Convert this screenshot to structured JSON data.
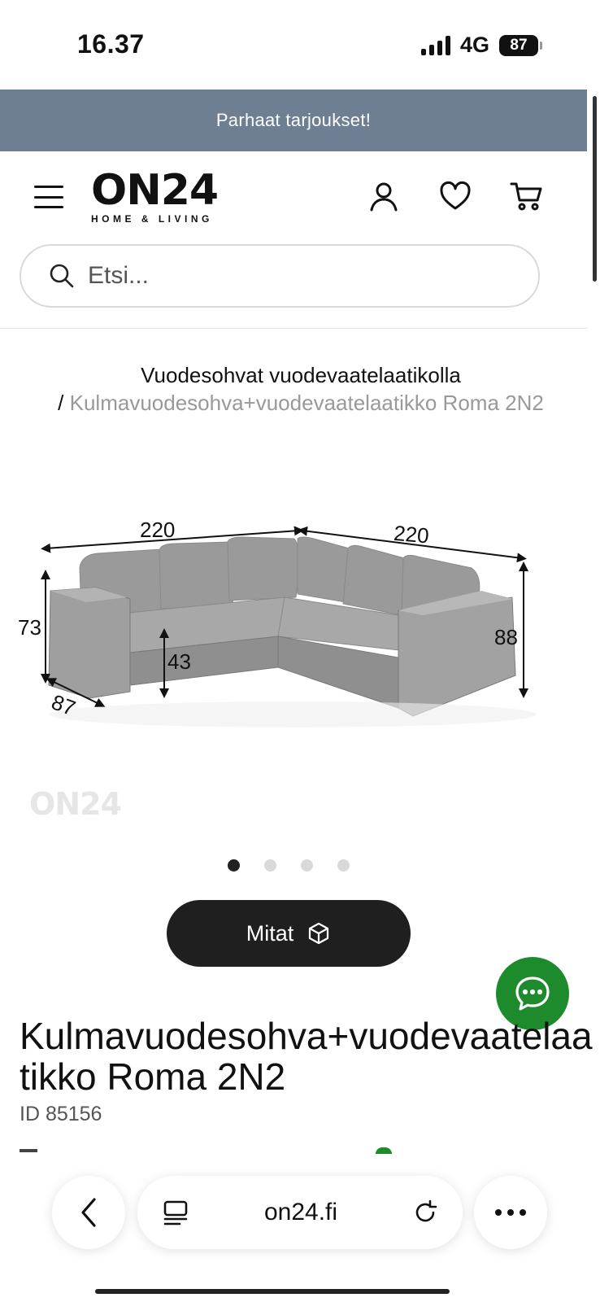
{
  "status_bar": {
    "time": "16.37",
    "network": "4G",
    "battery": "87"
  },
  "promo": {
    "text": "Parhaat tarjoukset!"
  },
  "header": {
    "logo_main": "ON24",
    "logo_sub": "HOME & LIVING",
    "icons": [
      "menu-icon",
      "user-icon",
      "heart-icon",
      "cart-icon"
    ]
  },
  "search": {
    "placeholder": "Etsi..."
  },
  "breadcrumb": {
    "parent": "Vuodesohvat vuodevaatelaatikolla",
    "separator": "/",
    "current": "Kulmavuodesohva+vuodevaatelaatikko Roma 2N2"
  },
  "image": {
    "dimensions": {
      "width_left": "220",
      "width_right": "220",
      "height_left": "73",
      "seat_height": "43",
      "height_right": "88",
      "depth": "87"
    },
    "watermark": "ON24"
  },
  "gallery": {
    "total": 4,
    "active": 1
  },
  "buttons": {
    "mitat": "Mitat"
  },
  "product": {
    "title": "Kulmavuodesohva+vuodevaatelaatikko Roma 2N2",
    "id": "ID 85156"
  },
  "browser": {
    "url": "on24.fi"
  },
  "colors": {
    "promo_bg": "#6e7f93",
    "chat_green": "#1d8a2b",
    "button_dark": "#1f1f1f"
  }
}
